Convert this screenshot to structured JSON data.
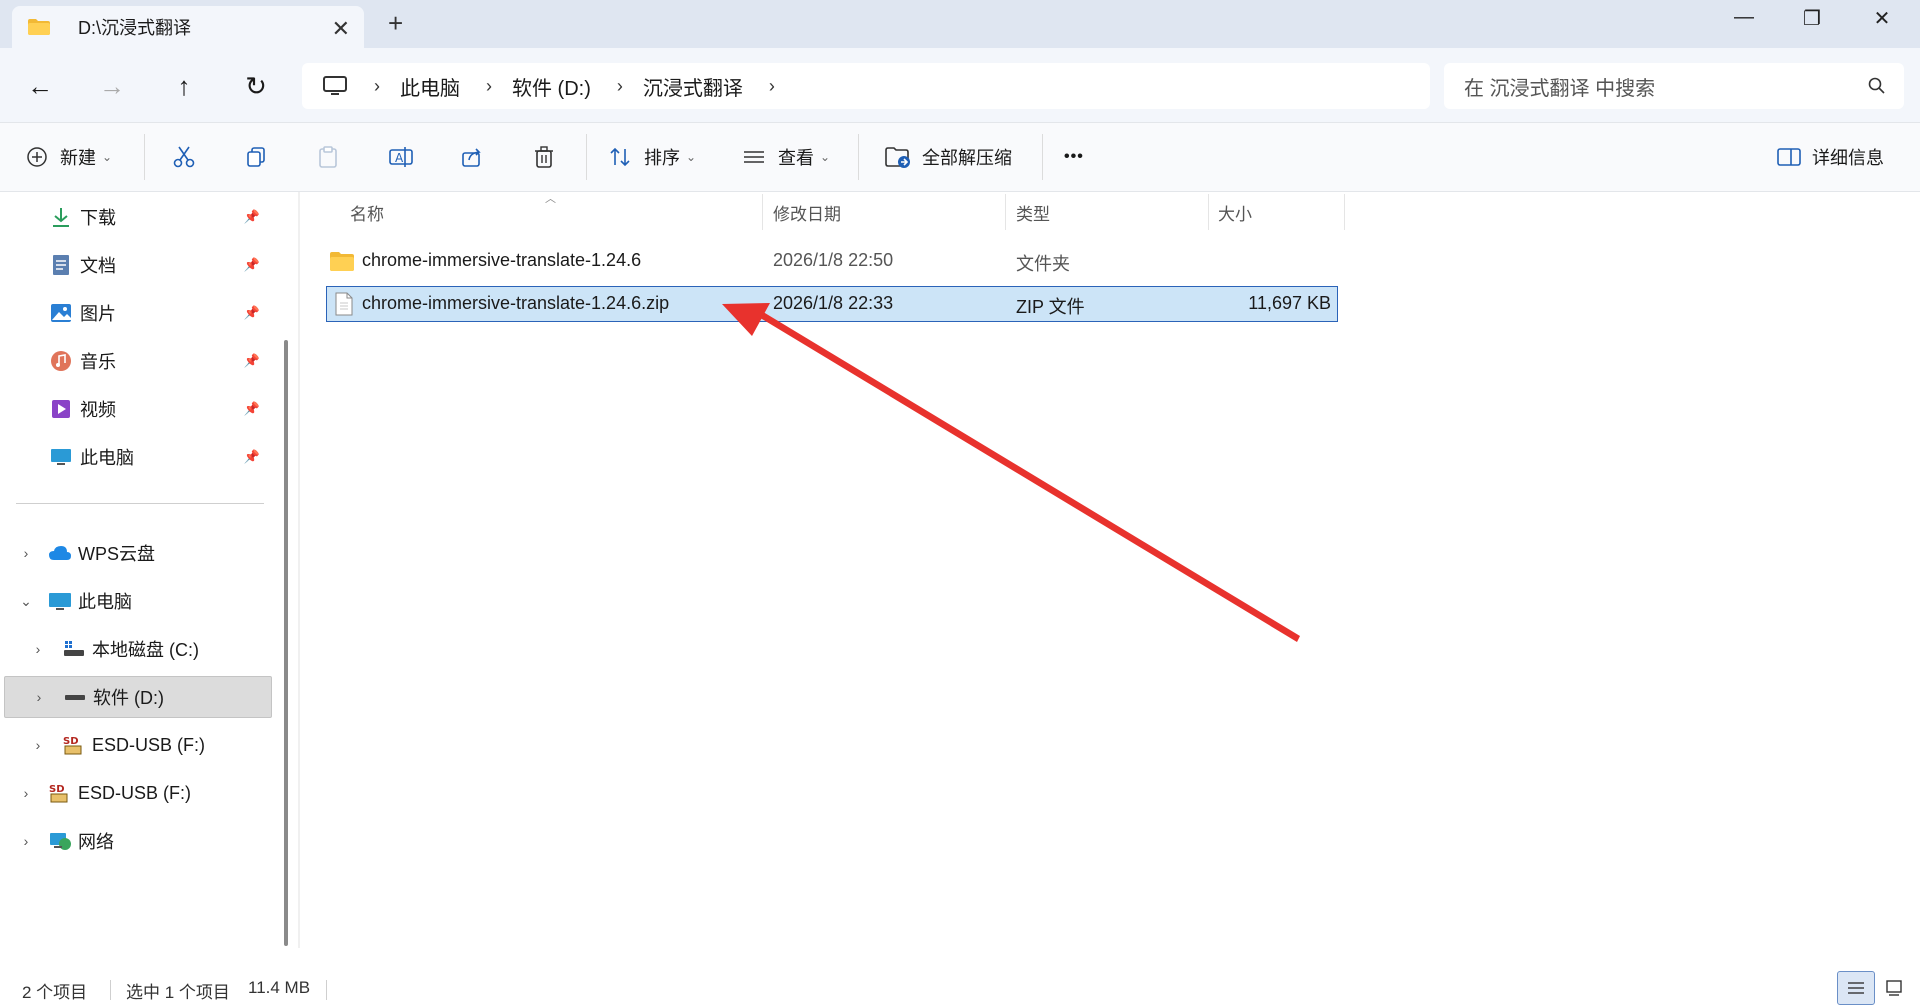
{
  "window": {
    "tab_title": "D:\\沉浸式翻译",
    "tab_close": "✕",
    "new_tab": "+",
    "minimize": "—",
    "maximize": "❐",
    "close": "✕"
  },
  "nav": {
    "back": "←",
    "forward": "→",
    "up": "↑",
    "refresh": "↻",
    "breadcrumbs": [
      "此电脑",
      "软件 (D:)",
      "沉浸式翻译"
    ],
    "search_placeholder": "在 沉浸式翻译 中搜索"
  },
  "toolbar": {
    "new_label": "新建",
    "sort_label": "排序",
    "view_label": "查看",
    "extract_label": "全部解压缩",
    "more_label": "•••",
    "details_label": "详细信息"
  },
  "sidebar": {
    "quick": [
      {
        "label": "下载"
      },
      {
        "label": "文档"
      },
      {
        "label": "图片"
      },
      {
        "label": "音乐"
      },
      {
        "label": "视频"
      },
      {
        "label": "此电脑"
      }
    ],
    "tree": [
      {
        "label": "WPS云盘"
      },
      {
        "label": "此电脑"
      },
      {
        "label": "本地磁盘 (C:)"
      },
      {
        "label": "软件 (D:)"
      },
      {
        "label": "ESD-USB (F:)"
      },
      {
        "label": "ESD-USB (F:)"
      },
      {
        "label": "网络"
      }
    ]
  },
  "columns": {
    "name": "名称",
    "modified": "修改日期",
    "type": "类型",
    "size": "大小"
  },
  "files": [
    {
      "name": "chrome-immersive-translate-1.24.6",
      "modified": "2026/1/8 22:50",
      "type": "文件夹",
      "size": ""
    },
    {
      "name": "chrome-immersive-translate-1.24.6.zip",
      "modified": "2026/1/8 22:33",
      "type": "ZIP 文件",
      "size": "11,697 KB"
    }
  ],
  "status": {
    "count": "2 个项目",
    "selection": "选中 1 个项目",
    "selection_size": "11.4 MB"
  },
  "colors": {
    "accent": "#2b63b8",
    "selection": "#cce4f7",
    "annotation_arrow": "#e8322d"
  }
}
